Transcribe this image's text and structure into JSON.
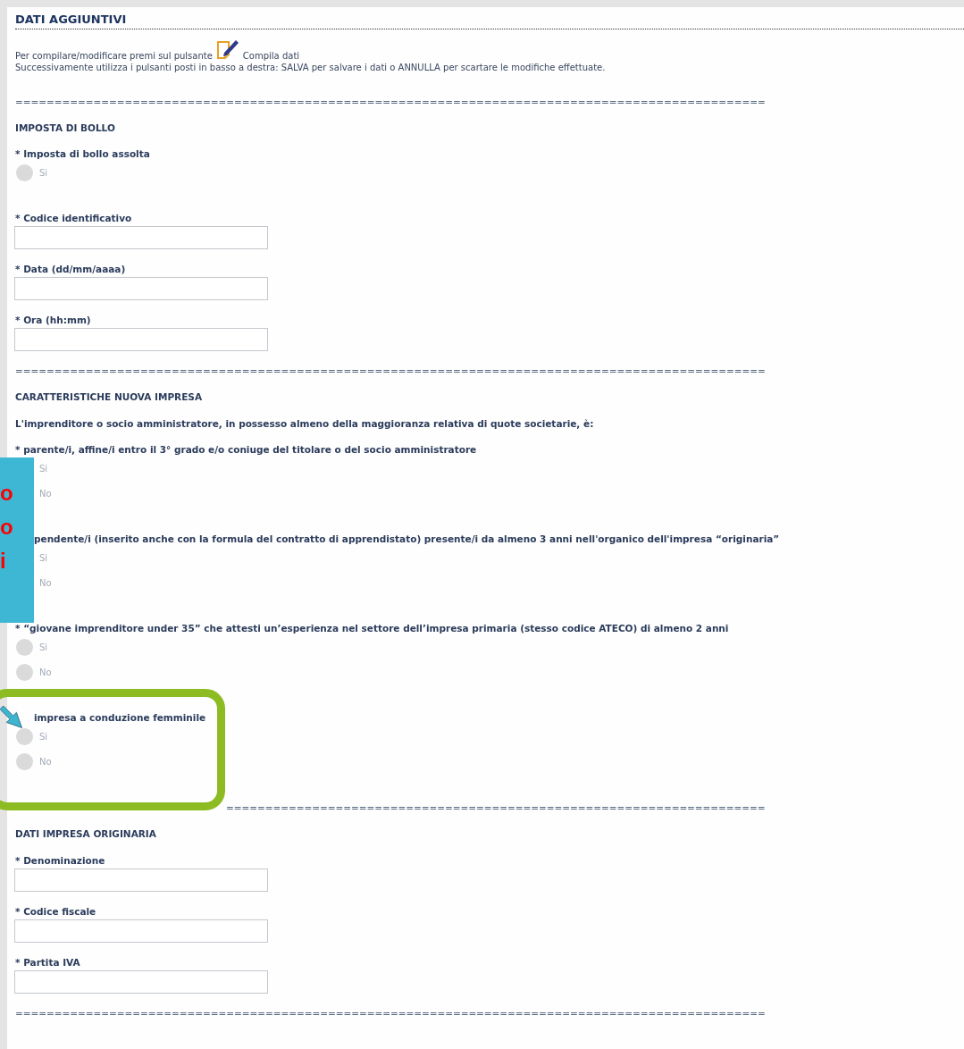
{
  "title": "DATI AGGIUNTIVI",
  "instructions": {
    "before_icon": "Per compilare/modificare premi sul pulsante",
    "after_icon": "Compila dati",
    "line_2": "Successivamente utilizza i pulsanti posti in basso a destra: SALVA per salvare i dati o ANNULLA per scartare le modifiche effettuate."
  },
  "sections": [
    {
      "separator": "================================================================================================",
      "heading": "IMPOSTA DI BOLLO",
      "items": [
        {
          "kind": "radio_question",
          "label": "* Imposta di bollo assolta",
          "partly_covered": false,
          "options": [
            {
              "label": "Si",
              "selected": false,
              "circle_covered": false
            }
          ]
        },
        {
          "kind": "field",
          "label": "* Codice identificativo"
        },
        {
          "kind": "field",
          "label": "* Data (dd/mm/aaaa)"
        },
        {
          "kind": "field",
          "label": "* Ora (hh:mm)"
        }
      ]
    },
    {
      "separator": "================================================================================================",
      "heading": "CARATTERISTICHE NUOVA IMPRESA",
      "items": [
        {
          "kind": "text",
          "label": "L'imprenditore o socio amministratore, in possesso almeno della maggioranza relativa di quote societarie, è:"
        },
        {
          "kind": "radio_question",
          "label": "* parente/i, affine/i entro il 3° grado e/o coniuge del titolare o del socio amministratore",
          "partly_covered": false,
          "options": [
            {
              "label": "Si",
              "selected": false,
              "circle_covered": true
            },
            {
              "label": "No",
              "selected": false,
              "circle_covered": true
            }
          ]
        },
        {
          "kind": "radio_question",
          "label": "pendente/i (inserito anche con la formula del contratto di apprendistato) presente/i da almeno 3 anni nell'organico dell'impresa “originaria”",
          "partly_covered": true,
          "options": [
            {
              "label": "Si",
              "selected": false,
              "circle_covered": true
            },
            {
              "label": "No",
              "selected": false,
              "circle_covered": true
            }
          ]
        },
        {
          "kind": "radio_question",
          "label": "* “giovane imprenditore under 35” che attesti un’esperienza nel settore dell’impresa primaria (stesso codice ATECO) di almeno 2 anni",
          "partly_covered": false,
          "options": [
            {
              "label": "Si",
              "selected": false,
              "circle_covered": false
            },
            {
              "label": "No",
              "selected": false,
              "circle_covered": false
            }
          ]
        },
        {
          "kind": "radio_question",
          "label": "impresa a conduzione femminile",
          "partly_covered": true,
          "options": [
            {
              "label": "Si",
              "selected": false,
              "circle_covered": false
            },
            {
              "label": "No",
              "selected": false,
              "circle_covered": false
            }
          ]
        }
      ]
    },
    {
      "separator": "=====================================================================",
      "separator_partly_covered": true,
      "heading": "DATI IMPRESA ORIGINARIA",
      "items": [
        {
          "kind": "field",
          "label": "* Denominazione"
        },
        {
          "kind": "field",
          "label": "* Codice fiscale"
        },
        {
          "kind": "field",
          "label": "* Partita IVA"
        }
      ]
    }
  ],
  "final_separator": "================================================================================================",
  "overlay": {
    "letters": [
      "o",
      "o",
      "i"
    ]
  }
}
